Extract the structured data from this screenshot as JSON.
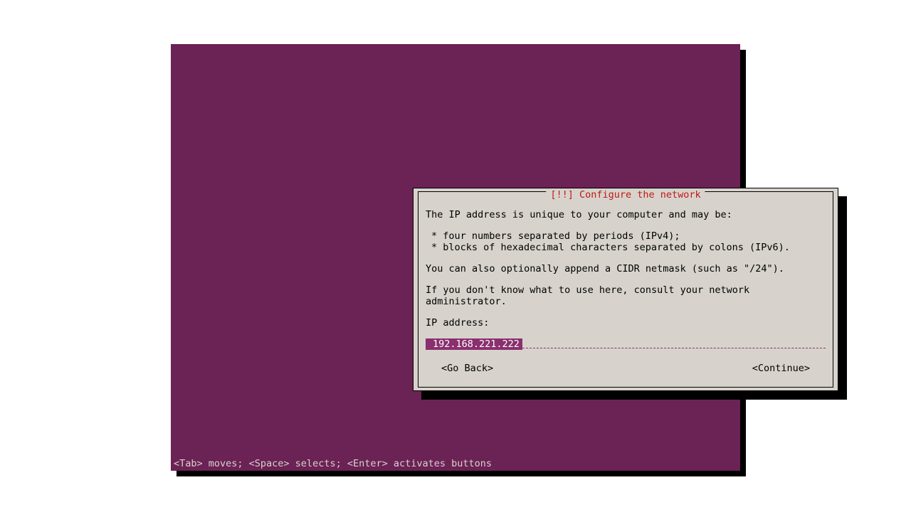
{
  "dialog": {
    "title": "[!!] Configure the network",
    "line1": "The IP address is unique to your computer and may be:",
    "bullet1": " * four numbers separated by periods (IPv4);",
    "bullet2": " * blocks of hexadecimal characters separated by colons (IPv6).",
    "line2": "You can also optionally append a CIDR netmask (such as \"/24\").",
    "line3": "If you don't know what to use here, consult your network administrator.",
    "field_label": "IP address:",
    "input_value": "192.168.221.222",
    "go_back": "<Go Back>",
    "continue": "<Continue>"
  },
  "help_bar": "<Tab> moves; <Space> selects; <Enter> activates buttons"
}
